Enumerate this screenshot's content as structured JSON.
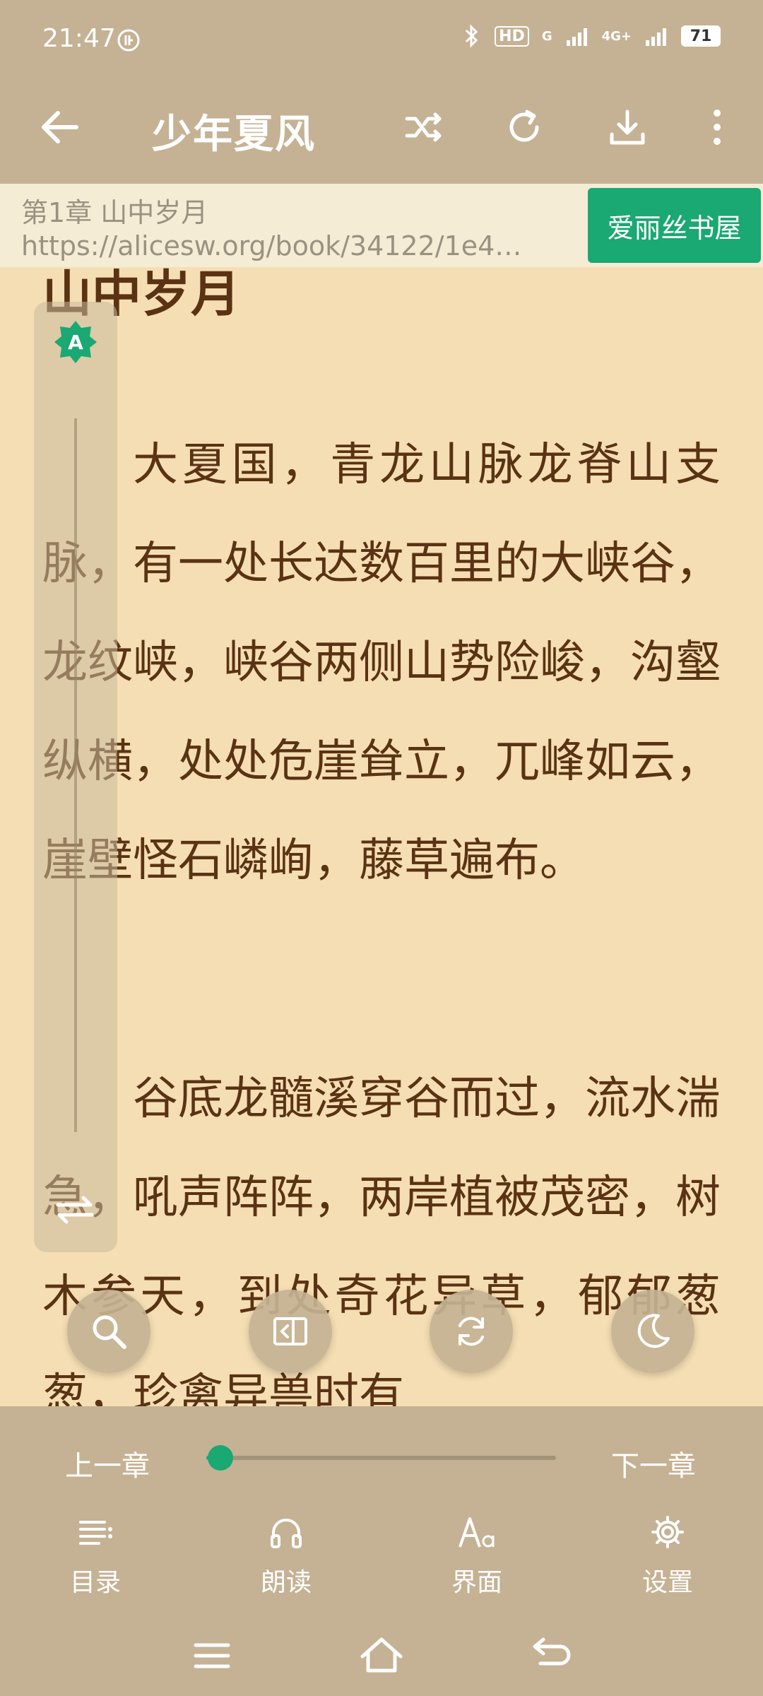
{
  "status_bar": {
    "time": "21:47",
    "network_hd": "HD",
    "network_g": "G",
    "network_4g": "4G+",
    "battery": "71"
  },
  "toolbar": {
    "title": "少年夏风"
  },
  "info_bar": {
    "chapter_title": "第1章 山中岁月",
    "url": "https://alicesw.org/book/34122/1e4…",
    "source_button": "爱丽丝书屋"
  },
  "content": {
    "heading": "山中岁月",
    "paragraphs": [
      "大夏国，青龙山脉龙脊山支脉，有一处长达数百里的大峡谷，龙纹峡，峡谷两侧山势险峻，沟壑纵横，处处危崖耸立，兀峰如云，崖壁怪石嶙峋，藤草遍布。",
      "谷底龙髓溪穿谷而过，流水湍急，吼声阵阵，两岸植被茂密，树木参天，到处奇花异草，郁郁葱葱，珍禽异兽时有"
    ]
  },
  "side_panel": {
    "auto_badge": "A"
  },
  "bottom_bar": {
    "prev_chapter": "上一章",
    "next_chapter": "下一章",
    "progress": 0.04,
    "menu": [
      {
        "label": "目录",
        "icon": "catalog-icon"
      },
      {
        "label": "朗读",
        "icon": "headphones-icon"
      },
      {
        "label": "界面",
        "icon": "font-style-icon"
      },
      {
        "label": "设置",
        "icon": "gear-icon"
      }
    ]
  },
  "colors": {
    "accent": "#1aa873",
    "bar": "#c5b294",
    "page": "#f5deb3",
    "text": "#5a3214"
  }
}
